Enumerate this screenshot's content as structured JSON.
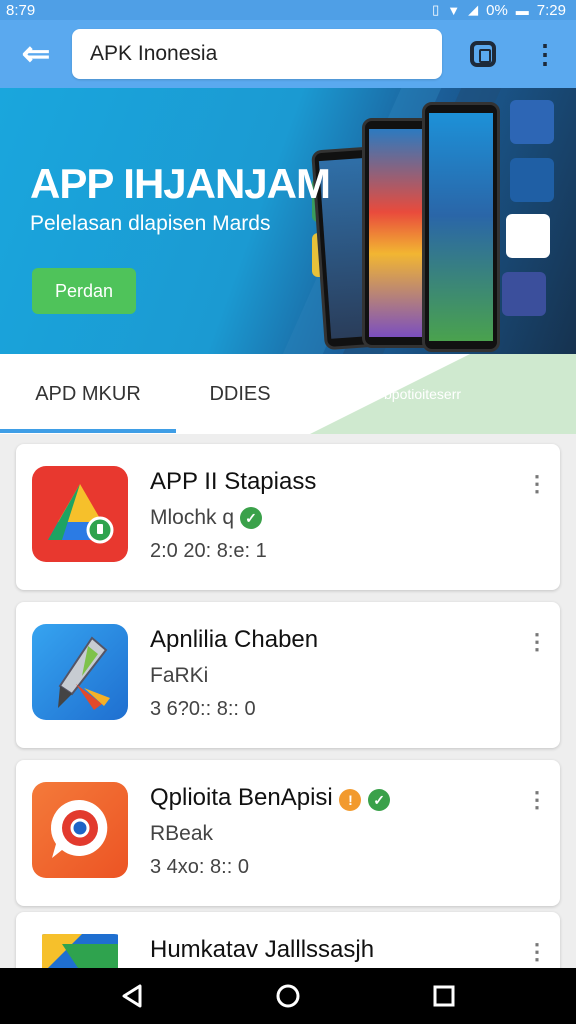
{
  "status_bar": {
    "time_left": "8:79",
    "battery": "0%",
    "time_right": "7:29"
  },
  "search": {
    "value": "APK Inonesia"
  },
  "banner": {
    "title": "APP IHJANJAM",
    "subtitle": "Pelelasan dlapisen Mards",
    "button_label": "Perdan"
  },
  "tabs": [
    {
      "label": "APD MKUR"
    },
    {
      "label": "DDIES"
    }
  ],
  "promo": {
    "label": "bpotioiteserr"
  },
  "apps": [
    {
      "name": "APP II Stapiass",
      "developer": "Mlochk q",
      "meta": "2:0 20: 8:e: 1",
      "icon": "google-drive-icon"
    },
    {
      "name": "Apnlilia Chaben",
      "developer": "FaRKi",
      "meta": "3 6?0:: 8:: 0",
      "icon": "pen-tool-icon"
    },
    {
      "name": "Qplioita BenApisi",
      "developer": "RBeak",
      "meta": "3 4xo: 8:: 0",
      "icon": "chrome-chat-icon"
    },
    {
      "name": "Humkatav Jalllssasjh",
      "developer": "",
      "meta": "",
      "icon": "maps-icon"
    }
  ],
  "colors": {
    "accent": "#5aa9ef",
    "button_green": "#4fc35a",
    "verified_green": "#3aa14a",
    "tab_indicator": "#3f9ee6"
  }
}
